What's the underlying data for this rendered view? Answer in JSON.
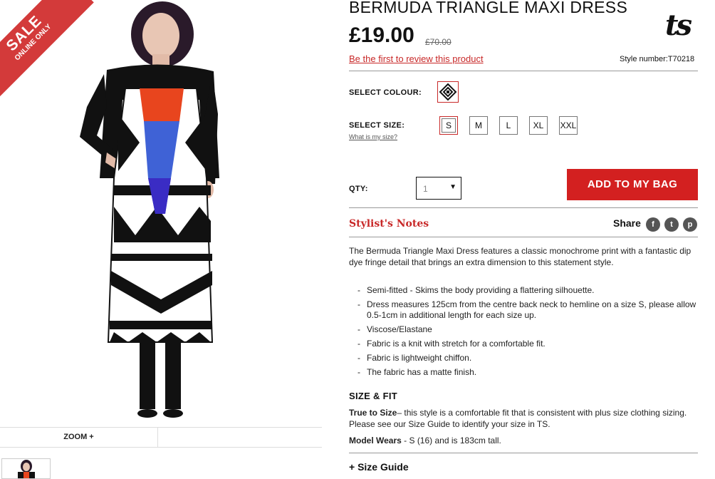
{
  "product": {
    "title": "BERMUDA TRIANGLE MAXI DRESS",
    "price": "£19.00",
    "old_price": "£70.00",
    "review_link": "Be the first to review this product",
    "style_number": "Style number:T70218",
    "brand_logo": "ts"
  },
  "badge": {
    "line1": "SALE",
    "line2": "ONLINE ONLY"
  },
  "gallery": {
    "zoom_label": "ZOOM +"
  },
  "options": {
    "colour_label": "SELECT COLOUR:",
    "size_label": "SELECT SIZE:",
    "size_help": "What is my size?",
    "sizes": [
      "S",
      "M",
      "L",
      "XL",
      "XXL"
    ],
    "selected_size": "S"
  },
  "cart": {
    "qty_label": "QTY:",
    "qty_value": "1",
    "add_button": "ADD TO MY BAG"
  },
  "notes": {
    "heading": "Stylist's Notes",
    "share_label": "Share",
    "social_icons": [
      "facebook-icon",
      "twitter-icon",
      "pinterest-icon"
    ],
    "description": "The Bermuda Triangle Maxi Dress features a classic monochrome print with a fantastic dip dye fringe detail that brings an extra dimension to this statement style.",
    "bullets": [
      "Semi-fitted - Skims the body providing a flattering silhouette.",
      "Dress measures 125cm from the centre back neck to hemline on a size S, please allow 0.5-1cm in additional length for each size up.",
      "Viscose/Elastane",
      "Fabric is a knit with stretch for a comfortable fit.",
      "Fabric is lightweight chiffon.",
      "The fabric has a matte finish."
    ]
  },
  "size_fit": {
    "heading": "SIZE & FIT",
    "true_label": "True to Size",
    "true_text": "– this style is a comfortable fit that is consistent with plus size clothing sizing. Please see our Size Guide to identify your size in TS.",
    "model_label": "Model Wears",
    "model_text": " - S (16) and is 183cm tall.",
    "size_guide": "+ Size Guide"
  },
  "colors": {
    "accent": "#c82828",
    "button": "#d32020"
  }
}
